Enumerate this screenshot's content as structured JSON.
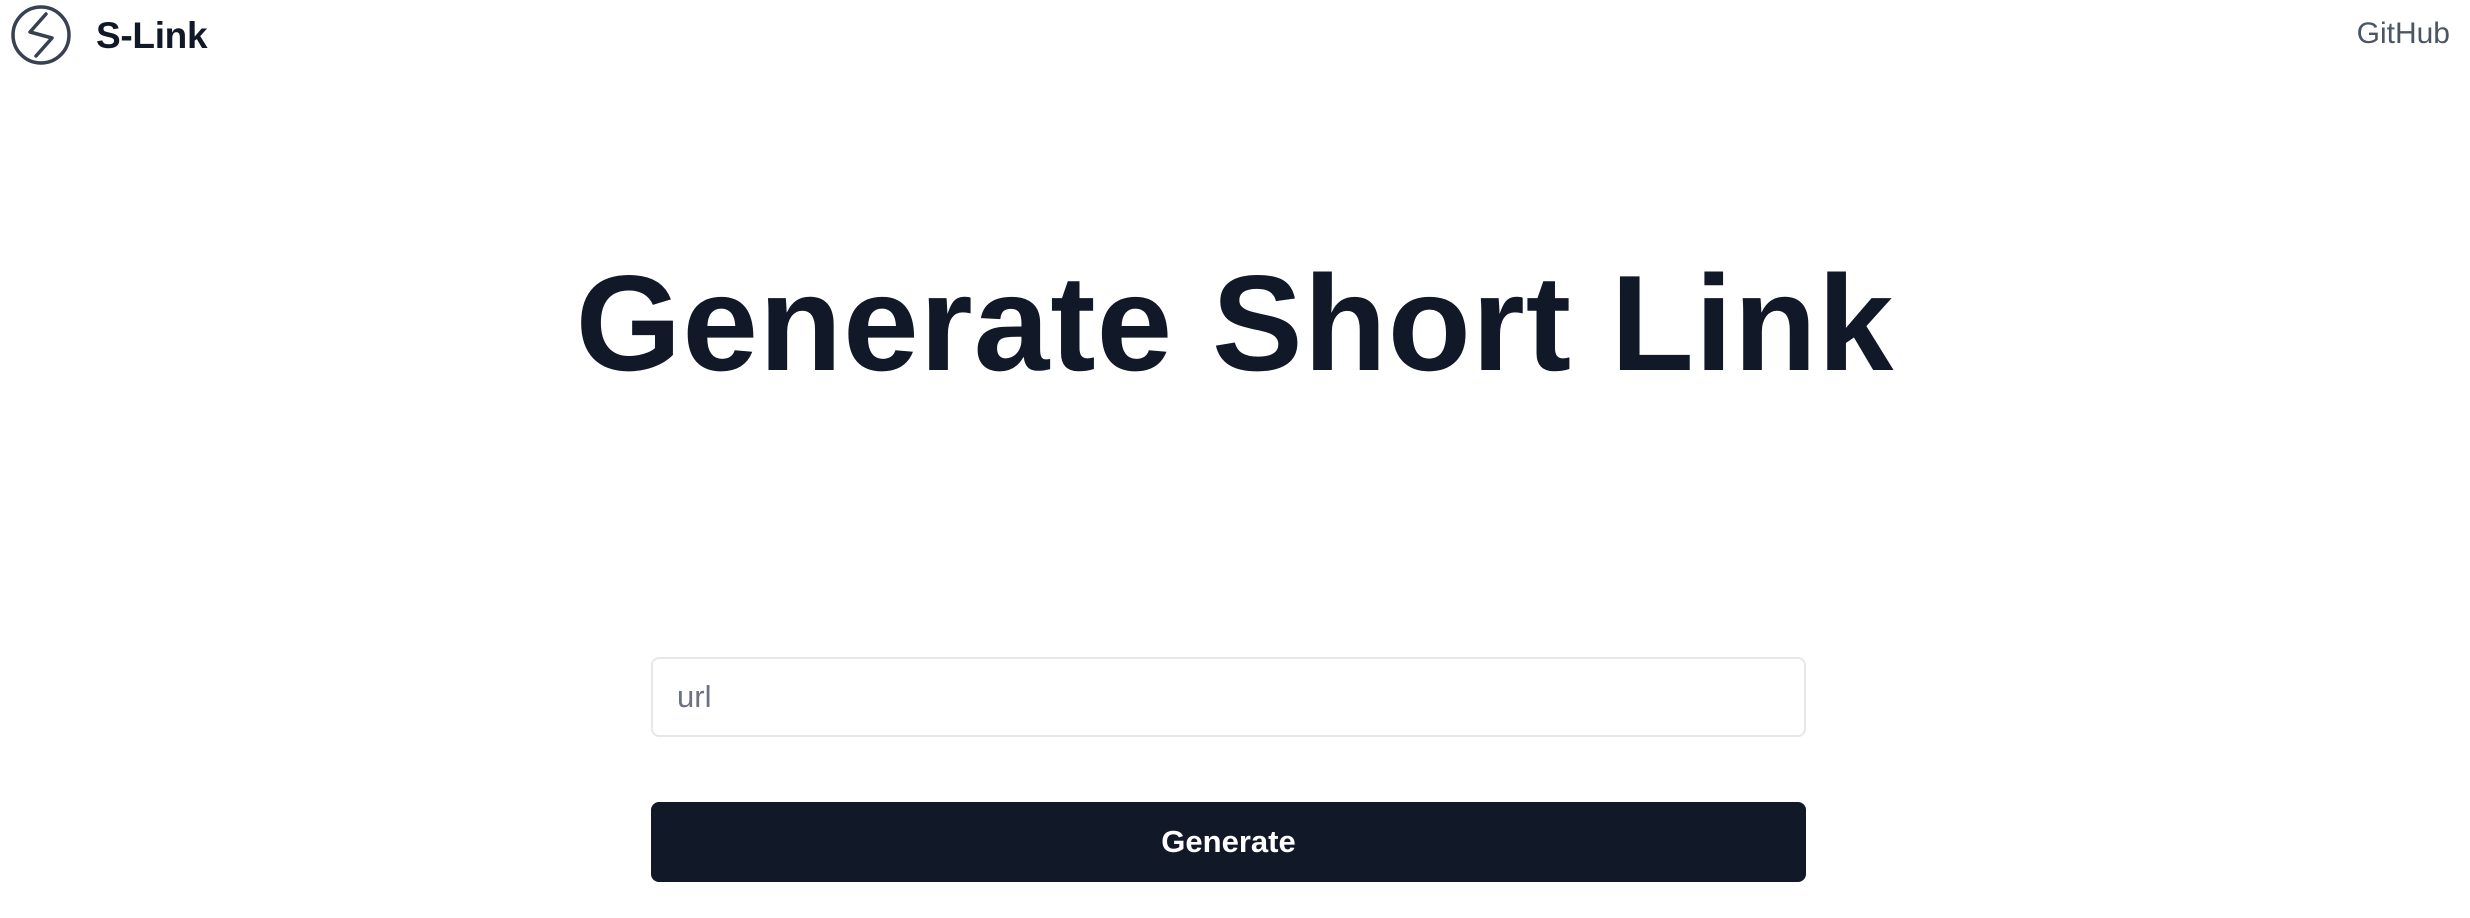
{
  "header": {
    "brand_name": "S-Link",
    "logo_icon": "s-logo-icon",
    "github_link": "GitHub"
  },
  "main": {
    "title": "Generate Short Link",
    "url_input": {
      "value": "",
      "placeholder": "url"
    },
    "generate_button": "Generate"
  },
  "colors": {
    "primary": "#111827",
    "muted_text": "#6b7280",
    "link_text": "#4b5563",
    "input_border": "#e5e7eb",
    "background": "#ffffff"
  }
}
